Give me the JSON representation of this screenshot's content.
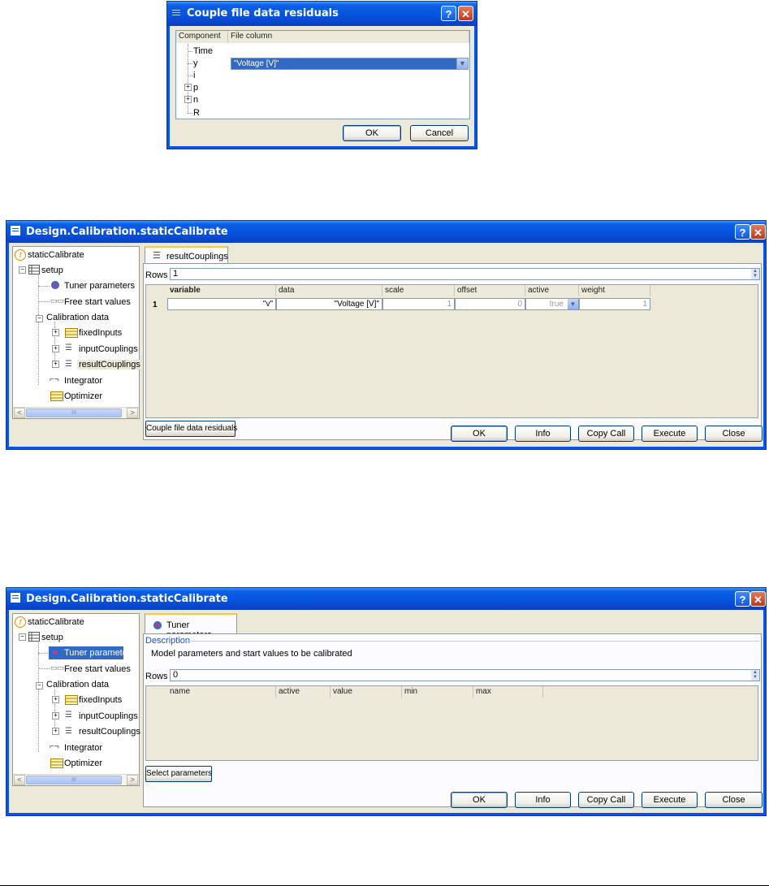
{
  "dialog1": {
    "title": "Couple file data residuals",
    "columns": [
      "Component",
      "File column"
    ],
    "tree": [
      "Time",
      "y",
      "i",
      "p",
      "n",
      "R"
    ],
    "selected_value": "\"Voltage [V]\"",
    "ok": "OK",
    "cancel": "Cancel"
  },
  "dialog2": {
    "title": "Design.Calibration.staticCalibrate",
    "tree": {
      "root": "staticCalibrate",
      "setup": "setup",
      "tuner": "Tuner parameters",
      "free": "Free start values",
      "calib": "Calibration data",
      "fixed": "fixedInputs",
      "input": "inputCouplings",
      "result": "resultCouplings",
      "integrator": "Integrator",
      "optimizer": "Optimizer"
    },
    "tab": "resultCouplings",
    "rows_label": "Rows",
    "rows_value": "1",
    "table": {
      "headers": [
        "variable",
        "data",
        "scale",
        "offset",
        "active",
        "weight"
      ],
      "row_index": "1",
      "row": [
        "\"v\"",
        "\"Voltage [V]\"",
        "1",
        "0",
        "true",
        "1"
      ]
    },
    "action_button": "Couple file data residuals",
    "buttons": [
      "OK",
      "Info",
      "Copy Call",
      "Execute",
      "Close"
    ]
  },
  "dialog3": {
    "title": "Design.Calibration.staticCalibrate",
    "tree": {
      "root": "staticCalibrate",
      "setup": "setup",
      "tuner": "Tuner parameters",
      "free": "Free start values",
      "calib": "Calibration data",
      "fixed": "fixedInputs",
      "input": "inputCouplings",
      "result": "resultCouplings",
      "integrator": "Integrator",
      "optimizer": "Optimizer"
    },
    "tab": "Tuner parameters",
    "description_label": "Description",
    "description_text": "Model parameters and start values to be calibrated",
    "rows_label": "Rows",
    "rows_value": "0",
    "table": {
      "headers": [
        "name",
        "active",
        "value",
        "min",
        "max"
      ]
    },
    "action_button": "Select parameters",
    "buttons": [
      "OK",
      "Info",
      "Copy Call",
      "Execute",
      "Close"
    ]
  },
  "icons": {
    "help": "?",
    "close": "✕",
    "scroll_left": "<",
    "scroll_right": ">",
    "scroll_thumb": "III"
  },
  "colors": {
    "title_bar": "#0a54e3",
    "client": "#ece9d8",
    "selection": "#316ac5",
    "tab_accent": "#ffc83c"
  }
}
